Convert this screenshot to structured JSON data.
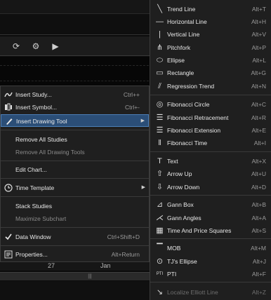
{
  "chart": {
    "axis_labels": [
      "27",
      "Jan"
    ],
    "scroll_thumb": "|||"
  },
  "context_menu": {
    "items": [
      {
        "label": "Insert Study...",
        "shortcut": "Ctrl++",
        "icon": "study-icon"
      },
      {
        "label": "Insert Symbol...",
        "shortcut": "Ctrl+-",
        "icon": "symbol-icon"
      },
      {
        "label": "Insert Drawing Tool",
        "shortcut": "",
        "icon": "drawing-tool-icon",
        "submenu": true,
        "highlighted": true
      },
      {
        "label": "Remove All Studies",
        "shortcut": ""
      },
      {
        "label": "Remove All Drawing Tools",
        "shortcut": "",
        "disabled": true
      },
      {
        "label": "Edit Chart...",
        "shortcut": ""
      },
      {
        "label": "Time Template",
        "shortcut": "",
        "icon": "clock-icon",
        "submenu": true
      },
      {
        "label": "Stack Studies",
        "shortcut": ""
      },
      {
        "label": "Maximize Subchart",
        "shortcut": "",
        "disabled": true
      },
      {
        "label": "Data Window",
        "shortcut": "Ctrl+Shift+D",
        "icon": "check-icon"
      },
      {
        "label": "Properties...",
        "shortcut": "Alt+Return",
        "icon": "properties-icon"
      }
    ]
  },
  "submenu": {
    "items": [
      {
        "label": "Trend Line",
        "shortcut": "Alt+T",
        "icon": "trend-line-icon",
        "glyph": "╲"
      },
      {
        "label": "Horizontal Line",
        "shortcut": "Alt+H",
        "icon": "horizontal-line-icon",
        "glyph": "—"
      },
      {
        "label": "Vertical Line",
        "shortcut": "Alt+V",
        "icon": "vertical-line-icon",
        "glyph": "|"
      },
      {
        "label": "Pitchfork",
        "shortcut": "Alt+P",
        "icon": "pitchfork-icon",
        "glyph": "⋔"
      },
      {
        "label": "Ellipse",
        "shortcut": "Alt+L",
        "icon": "ellipse-icon",
        "glyph": "⬭"
      },
      {
        "label": "Rectangle",
        "shortcut": "Alt+G",
        "icon": "rectangle-icon",
        "glyph": "▭"
      },
      {
        "label": "Regression Trend",
        "shortcut": "Alt+N",
        "icon": "regression-trend-icon",
        "glyph": "⫽"
      },
      {
        "label": "Fibonacci Circle",
        "shortcut": "Alt+C",
        "icon": "fibonacci-circle-icon",
        "glyph": "◎"
      },
      {
        "label": "Fibonacci Retracement",
        "shortcut": "Alt+R",
        "icon": "fibonacci-retracement-icon",
        "glyph": "☰"
      },
      {
        "label": "Fibonacci Extension",
        "shortcut": "Alt+E",
        "icon": "fibonacci-extension-icon",
        "glyph": "☰"
      },
      {
        "label": "Fibonacci Time",
        "shortcut": "Alt+I",
        "icon": "fibonacci-time-icon",
        "glyph": "‖"
      },
      {
        "label": "Text",
        "shortcut": "Alt+X",
        "icon": "text-icon",
        "glyph": "T"
      },
      {
        "label": "Arrow Up",
        "shortcut": "Alt+U",
        "icon": "arrow-up-icon",
        "glyph": "⇧"
      },
      {
        "label": "Arrow Down",
        "shortcut": "Alt+D",
        "icon": "arrow-down-icon",
        "glyph": "⇩"
      },
      {
        "label": "Gann Box",
        "shortcut": "Alt+B",
        "icon": "gann-box-icon",
        "glyph": "⊿"
      },
      {
        "label": "Gann Angles",
        "shortcut": "Alt+A",
        "icon": "gann-angles-icon",
        "glyph": "⋌"
      },
      {
        "label": "Time And Price Squares",
        "shortcut": "Alt+S",
        "icon": "time-price-squares-icon",
        "glyph": "▦"
      },
      {
        "label": "MOB",
        "shortcut": "Alt+M",
        "icon": "mob-icon",
        "glyph": "▔"
      },
      {
        "label": "TJ's Ellipse",
        "shortcut": "Alt+J",
        "icon": "tj-ellipse-icon",
        "glyph": "⊙"
      },
      {
        "label": "PTI",
        "shortcut": "Alt+F",
        "icon": "pti-icon",
        "glyph": "PTI"
      },
      {
        "label": "Localize Elliott Line",
        "shortcut": "Alt+Z",
        "icon": "elliott-line-icon",
        "glyph": "↘",
        "disabled": true
      }
    ]
  }
}
